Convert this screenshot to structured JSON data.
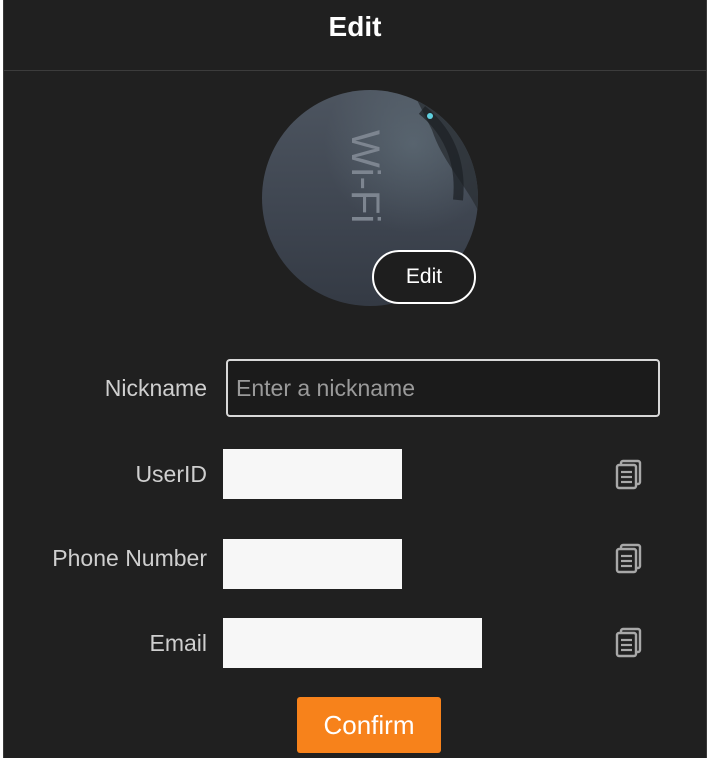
{
  "dialog": {
    "title": "Edit"
  },
  "avatar": {
    "edit_label": "Edit",
    "photo_text": "Wi-Fi"
  },
  "form": {
    "nickname": {
      "label": "Nickname",
      "placeholder": "Enter a nickname",
      "value": ""
    },
    "userid": {
      "label": "UserID",
      "value": ""
    },
    "phone": {
      "label": "Phone Number",
      "value": ""
    },
    "email": {
      "label": "Email",
      "value": ""
    }
  },
  "actions": {
    "confirm_label": "Confirm"
  },
  "colors": {
    "background": "#202020",
    "accent": "#f7821b",
    "text": "#cfcfcf"
  },
  "icons": {
    "copy": "copy-icon"
  }
}
